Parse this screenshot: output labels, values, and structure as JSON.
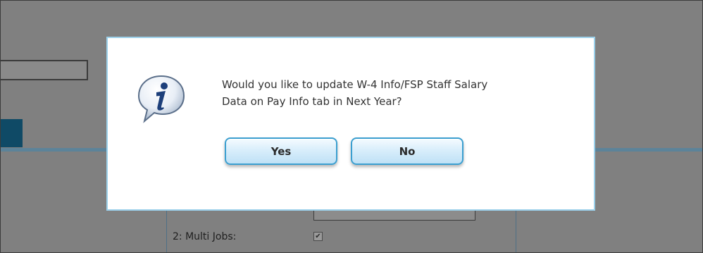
{
  "background": {
    "multi_jobs_label": "2: Multi Jobs:",
    "multi_jobs_checked": true
  },
  "dialog": {
    "icon": "info-speech-bubble-icon",
    "message_line1": "Would you like to update W-4 Info/FSP Staff Salary",
    "message_line2": "Data on Pay Info tab in Next Year?",
    "yes_label": "Yes",
    "no_label": "No",
    "accent_color": "#3b9fd0",
    "border_color": "#9bd0ea"
  }
}
